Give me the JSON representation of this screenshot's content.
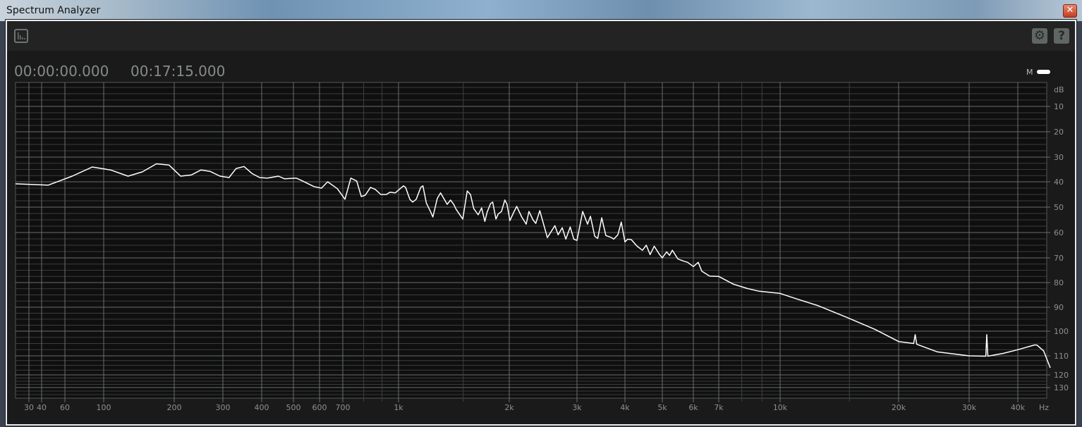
{
  "window": {
    "title": "Spectrum Analyzer",
    "close_label": "✕"
  },
  "toolbar": {
    "settings_icon": "gear-icon",
    "help_label": "?",
    "view_icon": "spectrum-view-icon"
  },
  "timeline": {
    "start": "00:00:00.000",
    "end": "00:17:15.000"
  },
  "legend": {
    "channel_label": "M",
    "channel_color": "#ffffff"
  },
  "chart_data": {
    "type": "line",
    "title": "",
    "xlabel": "Hz",
    "ylabel": "dB",
    "xscale": "log",
    "xlim": [
      20,
      48000
    ],
    "ylim": [
      0,
      135
    ],
    "y_inverted": true,
    "grid": true,
    "x_ticks": [
      {
        "v": 30,
        "l": "30"
      },
      {
        "v": 40,
        "l": "40"
      },
      {
        "v": 60,
        "l": "60"
      },
      {
        "v": 100,
        "l": "100"
      },
      {
        "v": 200,
        "l": "200"
      },
      {
        "v": 300,
        "l": "300"
      },
      {
        "v": 400,
        "l": "400"
      },
      {
        "v": 500,
        "l": "500"
      },
      {
        "v": 600,
        "l": "600"
      },
      {
        "v": 700,
        "l": "700"
      },
      {
        "v": 1000,
        "l": "1k"
      },
      {
        "v": 2000,
        "l": "2k"
      },
      {
        "v": 3000,
        "l": "3k"
      },
      {
        "v": 4000,
        "l": "4k"
      },
      {
        "v": 5000,
        "l": "5k"
      },
      {
        "v": 6000,
        "l": "6k"
      },
      {
        "v": 7000,
        "l": "7k"
      },
      {
        "v": 10000,
        "l": "10k"
      },
      {
        "v": 20000,
        "l": "20k"
      },
      {
        "v": 30000,
        "l": "30k"
      },
      {
        "v": 40000,
        "l": "40k"
      }
    ],
    "x_unit_label": "Hz",
    "y_unit_label": "dB",
    "y_ticks": [
      10,
      20,
      30,
      40,
      50,
      60,
      70,
      80,
      90,
      100,
      110,
      120,
      130
    ],
    "series": [
      {
        "name": "M",
        "color": "#ffffff",
        "freq": [
          20,
          45,
          66,
          86,
          107,
          127,
          146,
          168,
          190,
          211,
          231,
          250,
          270,
          293,
          314,
          331,
          351,
          372,
          394,
          416,
          450,
          470,
          510,
          528,
          577,
          608,
          633,
          675,
          710,
          737,
          765,
          788,
          808,
          836,
          862,
          893,
          925,
          947,
          979,
          1031,
          1045,
          1073,
          1093,
          1117,
          1149,
          1165,
          1190,
          1223,
          1240,
          1274,
          1301,
          1356,
          1385,
          1414,
          1434,
          1495,
          1537,
          1569,
          1602,
          1647,
          1682,
          1717,
          1741,
          1778,
          1803,
          1840,
          1866,
          1905,
          1945,
          1972,
          2008,
          2059,
          2092,
          2155,
          2213,
          2250,
          2306,
          2344,
          2401,
          2512,
          2628,
          2680,
          2747,
          2806,
          2881,
          2943,
          3000,
          3105,
          3196,
          3253,
          3338,
          3398,
          3480,
          3568,
          3691,
          3740,
          3835,
          3913,
          4000,
          4067,
          4156,
          4300,
          4440,
          4544,
          4648,
          4763,
          4919,
          5000,
          5129,
          5217,
          5304,
          5477,
          5638,
          5802,
          6000,
          6180,
          6316,
          6625,
          7000,
          7630,
          8260,
          8850,
          10000,
          11000,
          12500,
          14700,
          17400,
          20000,
          21800,
          22000,
          22200,
          25000,
          30000,
          33100,
          33300,
          33500,
          36700,
          40000,
          44000,
          44600,
          46400,
          48200
        ],
        "db": [
          40.8,
          41.3,
          37.7,
          34,
          35.2,
          37.7,
          36,
          32.7,
          33.2,
          37.7,
          37.2,
          35.2,
          35.8,
          37.7,
          38.3,
          34.6,
          33.8,
          36.6,
          38.3,
          38.5,
          37.7,
          38.8,
          38.5,
          39.4,
          41.9,
          42.5,
          40,
          42.7,
          46.9,
          38.5,
          39.7,
          45.8,
          45.3,
          42.2,
          43,
          45,
          45,
          44.1,
          44.4,
          41.6,
          42.2,
          46.9,
          48,
          46.9,
          42.2,
          41.6,
          48.3,
          51.9,
          53.9,
          46.6,
          44.4,
          48.9,
          47.2,
          49,
          50.8,
          54.7,
          43.6,
          45,
          50.6,
          53,
          50.3,
          55.6,
          52,
          48.6,
          48,
          54.7,
          52.7,
          51.7,
          47.2,
          48.9,
          55.3,
          51.7,
          49.7,
          53.9,
          56.7,
          51.7,
          55,
          56.4,
          51.4,
          62,
          57.3,
          60.9,
          58.1,
          62.6,
          57.8,
          62.6,
          63.1,
          51.7,
          56.7,
          53.6,
          61.5,
          62.3,
          54.2,
          61.2,
          62,
          62.6,
          60.9,
          55.9,
          63.7,
          62.6,
          62.8,
          65.4,
          67,
          65,
          68.7,
          65.4,
          68.7,
          70,
          67.6,
          69,
          67,
          70.4,
          71.2,
          71.8,
          73.5,
          71.8,
          75.4,
          77.4,
          77.5,
          80.7,
          82.4,
          83.5,
          84.4,
          86.6,
          89.4,
          94.1,
          99.2,
          104.2,
          105,
          101.4,
          105.3,
          108.4,
          110,
          110.2,
          101.4,
          110.2,
          109,
          107.5,
          105.6,
          105.6,
          108,
          116.3
        ]
      }
    ]
  }
}
